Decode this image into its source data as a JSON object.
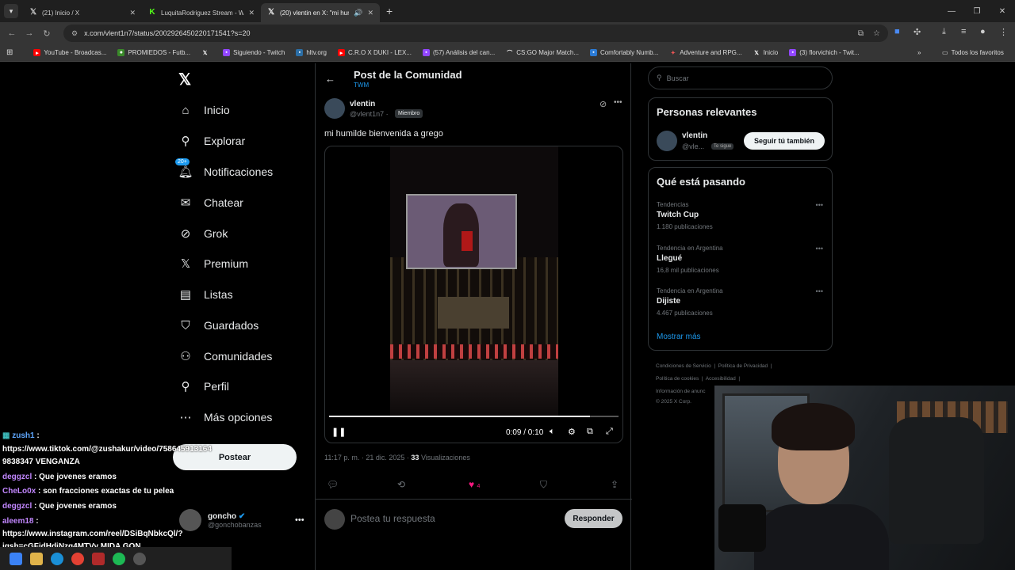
{
  "browser": {
    "tabs": [
      {
        "title": "(21) Inicio / X",
        "icon": "x-logo-icon"
      },
      {
        "title": "LuquitaRodriguez Stream - Wat",
        "icon": "kick-logo-icon"
      },
      {
        "title": "(20) vlentin en X: \"mi humil",
        "icon": "x-logo-icon"
      }
    ],
    "url": "x.com/vlent1n7/status/2002926450220171541?s=20",
    "bookmarks": [
      "YouTube - Broadcas...",
      "PROMIEDOS - Futb...",
      "",
      "Siguiendo - Twitch",
      "hltv.org",
      "C.R.O X DUKI - LEX...",
      "(57) Análisis del can...",
      "CS:GO Major Match...",
      "Comfortably Numb...",
      "Adventure and RPG...",
      "Inicio",
      "(3) florvichich - Twit..."
    ],
    "all_bookmarks": "Todos los favoritos"
  },
  "sidebar": {
    "items": [
      {
        "label": "Inicio",
        "icon": "home-icon"
      },
      {
        "label": "Explorar",
        "icon": "search-icon"
      },
      {
        "label": "Notificaciones",
        "icon": "bell-icon",
        "badge": "20+"
      },
      {
        "label": "Chatear",
        "icon": "mail-icon"
      },
      {
        "label": "Grok",
        "icon": "grok-icon"
      },
      {
        "label": "Premium",
        "icon": "x-logo-icon"
      },
      {
        "label": "Listas",
        "icon": "list-icon"
      },
      {
        "label": "Guardados",
        "icon": "bookmark-icon"
      },
      {
        "label": "Comunidades",
        "icon": "people-icon"
      },
      {
        "label": "Perfil",
        "icon": "person-icon"
      },
      {
        "label": "Más opciones",
        "icon": "more-circle-icon"
      }
    ],
    "post_button": "Postear",
    "account": {
      "name": "goncho",
      "handle": "@gonchobanzas"
    }
  },
  "main": {
    "title": "Post de la Comunidad",
    "subtitle": "TWM",
    "post": {
      "author_name": "vlentin",
      "author_handle": "@vlent1n7 ·",
      "member_badge": "Miembro",
      "text": "mi humilde bienvenida a grego",
      "video": {
        "time": "0:09 / 0:10",
        "progress": 0.9
      },
      "timestamp": "11:17 p. m. · 21 dic. 2025 ·",
      "views_count": "33",
      "views_label": "Visualizaciones",
      "likes": "4"
    },
    "reply_placeholder": "Postea tu respuesta",
    "reply_button": "Responder"
  },
  "right": {
    "search_placeholder": "Buscar",
    "relevant_title": "Personas relevantes",
    "relevant": {
      "name": "vlentin",
      "handle": "@vle...",
      "tag": "Te sigue",
      "button": "Seguir tú también"
    },
    "trends_title": "Qué está pasando",
    "trends": [
      {
        "context": "Tendencias",
        "name": "Twitch Cup",
        "count": "1.180 publicaciones"
      },
      {
        "context": "Tendencia en Argentina",
        "name": "Llegué",
        "count": "16,8 mil publicaciones"
      },
      {
        "context": "Tendencia en Argentina",
        "name": "Dijiste",
        "count": "4.467 publicaciones"
      }
    ],
    "show_more": "Mostrar más",
    "footer": [
      "Condiciones de Servicio",
      "Política de Privacidad",
      "Política de cookies",
      "Accesibilidad",
      "Información de anunc",
      "© 2025 X Corp."
    ]
  },
  "chat": [
    {
      "user": "zush1",
      "text": " :"
    },
    {
      "user": "",
      "text": "https://www.tiktok.com/@zushakur/video/758645913164"
    },
    {
      "user": "",
      "text": "9838347 VENGANZA"
    },
    {
      "user": "deggzcl",
      "text": " : Que jovenes eramos"
    },
    {
      "user": "CheLo0x",
      "text": " : son fracciones exactas de tu pelea"
    },
    {
      "user": "deggzcl",
      "text": " : Que jovenes eramos"
    },
    {
      "user": "aleem18",
      "text": " :"
    },
    {
      "user": "",
      "text": "https://www.instagram.com/reel/DSiBqNbkcQl/?"
    },
    {
      "user": "",
      "text": "igsh=cGFjdHdjNzg4MTVy MIDA GON"
    }
  ]
}
